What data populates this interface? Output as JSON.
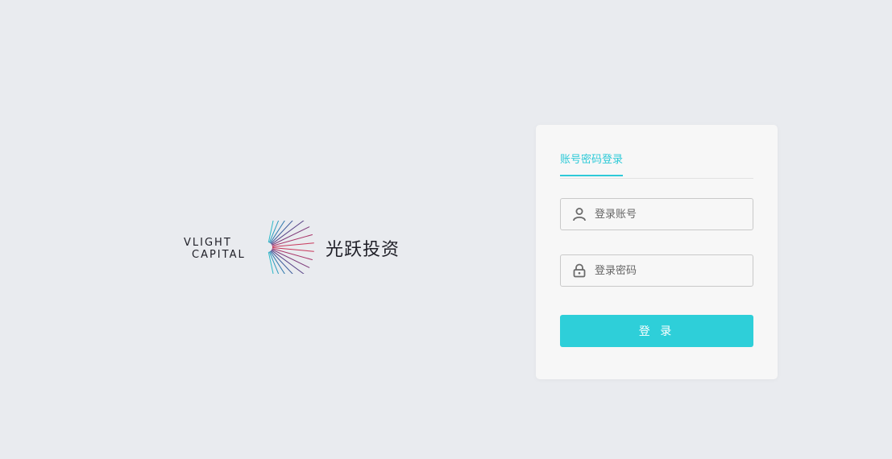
{
  "brand": {
    "name_en_line1": "VLIGHT",
    "name_en_line2": "CAPITAL",
    "name_cn": "光跃投资",
    "logo_icon": "sunburst-fan-icon"
  },
  "login": {
    "tab_label": "账号密码登录",
    "account": {
      "placeholder": "登录账号",
      "icon": "user-icon",
      "value": ""
    },
    "password": {
      "placeholder": "登录密码",
      "icon": "lock-icon",
      "value": ""
    },
    "submit_label": "登 录"
  },
  "colors": {
    "background": "#e9ebef",
    "card": "#f7f7f7",
    "accent": "#2ecfd9",
    "text_dark": "#1e1e26"
  }
}
